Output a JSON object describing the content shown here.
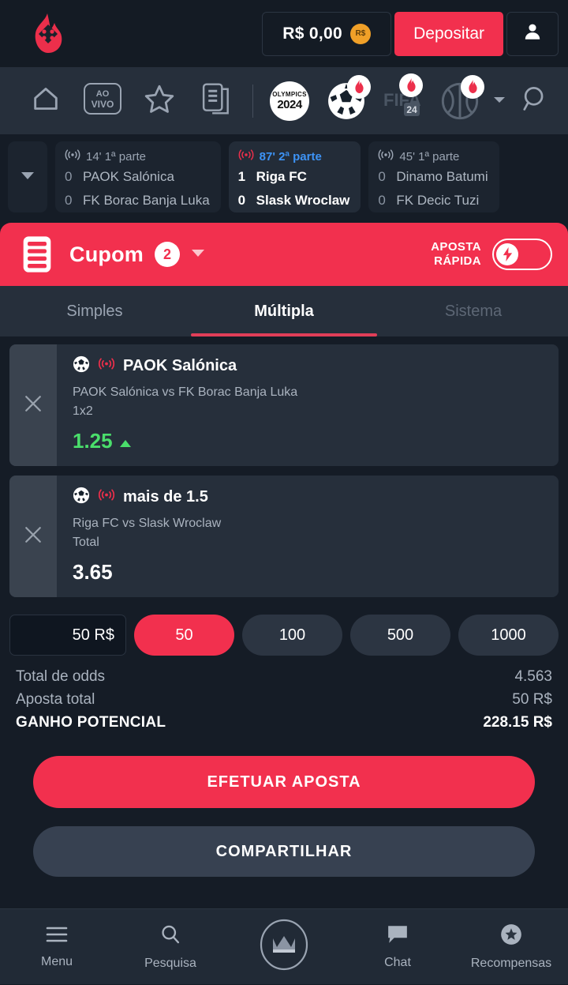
{
  "colors": {
    "brand_red": "#f2304e",
    "page_bg": "#151c26",
    "panel_bg": "#262f3b",
    "nav_bg": "#262f3b",
    "odd_up_green": "#4ade6b",
    "live_blue": "#3d93f5",
    "coin_orange": "#f0a028"
  },
  "topbar": {
    "logo_icon": "flame-dice-logo",
    "balance": "R$ 0,00",
    "coin_badge": "R$",
    "deposit_label": "Depositar",
    "profile_icon": "person-icon"
  },
  "navbar": {
    "items": [
      {
        "icon": "home-icon",
        "label": "Home"
      },
      {
        "icon": "live-icon",
        "label_top": "AO",
        "label_bottom": "VIVO"
      },
      {
        "icon": "star-icon",
        "label": "Favoritos"
      },
      {
        "icon": "bet-history-icon",
        "label": "Apostas"
      }
    ],
    "sports": [
      {
        "icon": "olympics-icon",
        "title_top": "OLYMPICS",
        "title_bottom": "2024",
        "hot": false
      },
      {
        "icon": "soccer-ball-icon",
        "label": "Futebol",
        "hot": true
      },
      {
        "icon": "fifa24-icon",
        "label_main": "FIFA",
        "label_badge": "24",
        "hot": true
      },
      {
        "icon": "basketball-icon",
        "label": "Basquete",
        "hot": true
      }
    ],
    "more_icon": "chevron-down-icon",
    "search_icon": "search-icon"
  },
  "ticker": {
    "collapse_icon": "chevron-down-icon",
    "matches": [
      {
        "live_icon": "live-signal-icon",
        "time": "14' 1ª parte",
        "active": false,
        "home_score": "0",
        "home_team": "PAOK Salónica",
        "away_score": "0",
        "away_team": "FK Borac Banja Luka"
      },
      {
        "live_icon": "live-signal-icon",
        "time": "87' 2ª parte",
        "active": true,
        "home_score": "1",
        "home_team": "Riga FC",
        "away_score": "0",
        "away_team": "Slask Wroclaw"
      },
      {
        "live_icon": "live-signal-icon",
        "time": "45' 1ª parte",
        "active": false,
        "home_score": "0",
        "home_team": "Dinamo Batumi",
        "away_score": "0",
        "away_team": "FK Decic Tuzi"
      }
    ]
  },
  "coupon": {
    "slip_icon": "betslip-icon",
    "title": "Cupom",
    "count": "2",
    "caret_icon": "caret-down-icon",
    "quickbet_line1": "APOSTA",
    "quickbet_line2": "RÁPIDA",
    "quickbet_on": false,
    "quickbet_icon": "lightning-bolt-icon",
    "tabs": [
      {
        "label": "Simples",
        "state": "normal"
      },
      {
        "label": "Múltipla",
        "state": "active"
      },
      {
        "label": "Sistema",
        "state": "disabled"
      }
    ]
  },
  "bets": [
    {
      "remove_icon": "close-icon",
      "sport_icon": "soccer-ball-icon",
      "live_icon": "live-signal-icon",
      "pick": "PAOK Salónica",
      "match": "PAOK Salónica vs FK Borac Banja Luka",
      "market": "1x2",
      "odd": "1.25",
      "trend": "up",
      "trend_icon": "triangle-up-icon"
    },
    {
      "remove_icon": "close-icon",
      "sport_icon": "soccer-ball-icon",
      "live_icon": "live-signal-icon",
      "pick": "mais de 1.5",
      "match": "Riga FC vs Slask Wroclaw",
      "market": "Total",
      "odd": "3.65",
      "trend": "flat",
      "trend_icon": ""
    }
  ],
  "stake": {
    "input_value": "50 R$",
    "input_placeholder": "0 R$",
    "chips": [
      {
        "label": "50",
        "active": true
      },
      {
        "label": "100",
        "active": false
      },
      {
        "label": "500",
        "active": false
      },
      {
        "label": "1000",
        "active": false
      }
    ]
  },
  "summary": {
    "odds_label": "Total de odds",
    "odds_value": "4.563",
    "stake_label": "Aposta total",
    "stake_value": "50 R$",
    "payout_label": "GANHO POTENCIAL",
    "payout_value": "228.15 R$"
  },
  "actions": {
    "primary_label": "EFETUAR APOSTA",
    "secondary_label": "COMPARTILHAR"
  },
  "bottomnav": {
    "items": [
      {
        "icon": "hamburger-menu-icon",
        "label": "Menu"
      },
      {
        "icon": "search-icon",
        "label": "Pesquisa"
      },
      {
        "icon": "crown-icon",
        "label": ""
      },
      {
        "icon": "chat-bubble-icon",
        "label": "Chat"
      },
      {
        "icon": "star-badge-icon",
        "label": "Recompensas"
      }
    ]
  }
}
